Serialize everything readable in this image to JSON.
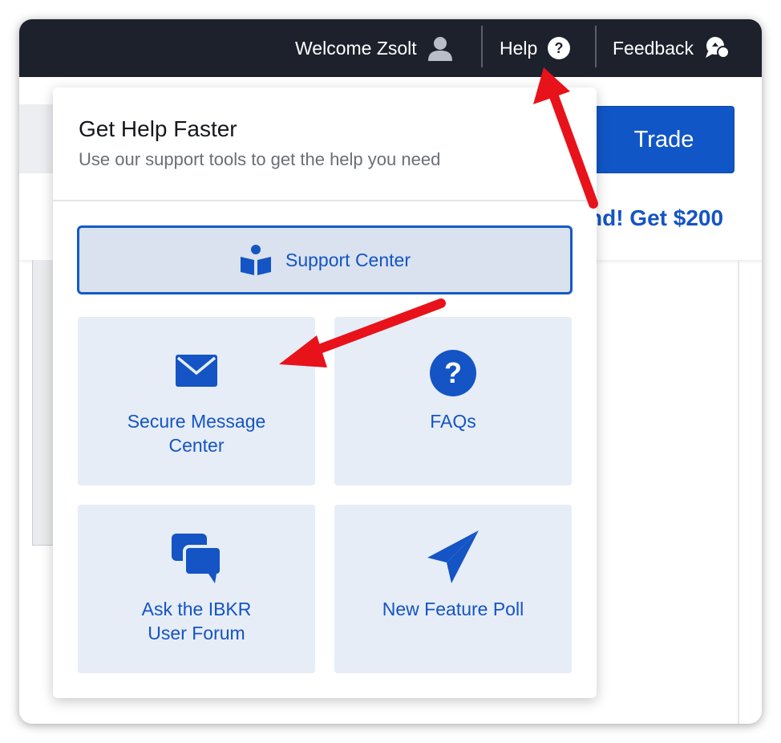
{
  "topbar": {
    "welcome_label": "Welcome Zsolt",
    "help_label": "Help",
    "feedback_label": "Feedback"
  },
  "background": {
    "trade_label": "Trade",
    "promo_text": "nd! Get $200"
  },
  "help_menu": {
    "title": "Get Help Faster",
    "subtitle": "Use our support tools to get the help you need",
    "support_center_label": "Support Center",
    "tiles": [
      {
        "line1": "Secure Message",
        "line2": "Center",
        "icon": "envelope-icon"
      },
      {
        "line1": "FAQs",
        "line2": "",
        "icon": "question-circle-icon"
      },
      {
        "line1": "Ask the IBKR",
        "line2": "User Forum",
        "icon": "chat-bubbles-icon"
      },
      {
        "line1": "New Feature Poll",
        "line2": "",
        "icon": "paper-plane-icon"
      }
    ]
  },
  "colors": {
    "accent": "#1454c4",
    "topbar_bg": "#1d212c",
    "tile_bg": "#e6edf7",
    "annotation_arrow": "#e8121b"
  }
}
